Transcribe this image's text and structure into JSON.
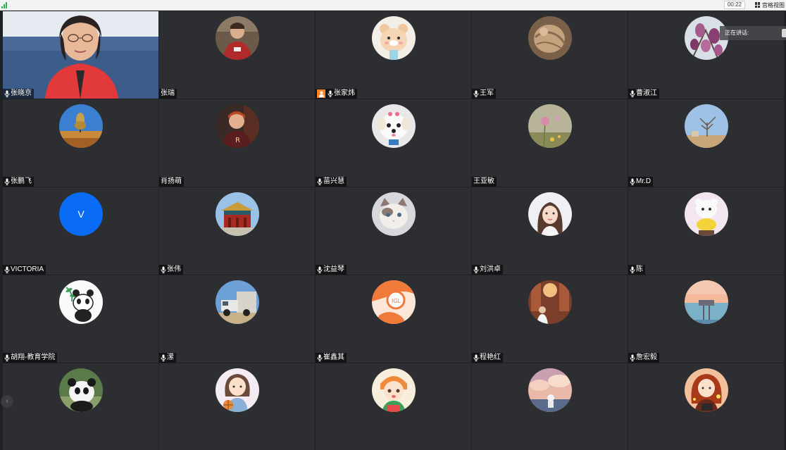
{
  "topbar": {
    "timer": "00:22",
    "grid_view_label": "宫格视图"
  },
  "speaking": {
    "label": "正在讲话:"
  },
  "tiles": [
    {
      "name": "张晓京",
      "avatar": "video",
      "mic": true
    },
    {
      "name": "张瑞",
      "avatar": "man-photo",
      "mic": false
    },
    {
      "name": "张家炜",
      "avatar": "bear-cartoon",
      "mic": true,
      "host": true
    },
    {
      "name": "王军",
      "avatar": "hand-photo",
      "mic": true
    },
    {
      "name": "曹淑江",
      "avatar": "magnolia-flowers",
      "mic": true
    },
    {
      "name": "张鹏飞",
      "avatar": "tree-landscape",
      "mic": true
    },
    {
      "name": "肖扬萌",
      "avatar": "boy-photo",
      "mic": false
    },
    {
      "name": "苗兴慧",
      "avatar": "white-dog",
      "mic": true
    },
    {
      "name": "王亚敏",
      "avatar": "pink-flower",
      "mic": false
    },
    {
      "name": "Mr.D",
      "avatar": "bare-tree",
      "mic": true
    },
    {
      "name": "VICTORIA",
      "avatar": "letter-v",
      "letter": "V",
      "mic": true
    },
    {
      "name": "张伟",
      "avatar": "palace",
      "mic": true
    },
    {
      "name": "沈益琴",
      "avatar": "cat",
      "mic": true
    },
    {
      "name": "刘洪卓",
      "avatar": "girl-portrait",
      "mic": true
    },
    {
      "name": "陈",
      "avatar": "cartoon-toy",
      "mic": true
    },
    {
      "name": "胡翔-教育学院",
      "avatar": "panda-bamboo",
      "mic": true
    },
    {
      "name": "潆",
      "avatar": "vintage-truck",
      "mic": true
    },
    {
      "name": "崔鑫其",
      "avatar": "orange-cartoon",
      "mic": true
    },
    {
      "name": "程艳红",
      "avatar": "woman-library",
      "mic": true
    },
    {
      "name": "詹宏毅",
      "avatar": "sunset-pier",
      "mic": true
    },
    {
      "name": "",
      "avatar": "panda-photo",
      "mic": false
    },
    {
      "name": "",
      "avatar": "girl-basketball",
      "mic": false
    },
    {
      "name": "",
      "avatar": "girl-fox-cartoon",
      "mic": false
    },
    {
      "name": "",
      "avatar": "astronaut-clouds",
      "mic": false
    },
    {
      "name": "",
      "avatar": "girl-book-cartoon",
      "mic": false
    }
  ],
  "colors": {
    "tile_bg": "#2c2e31",
    "grid_bg": "#1f2124",
    "letter_avatar": "#0a6cf5",
    "host_badge": "#f5832a"
  }
}
